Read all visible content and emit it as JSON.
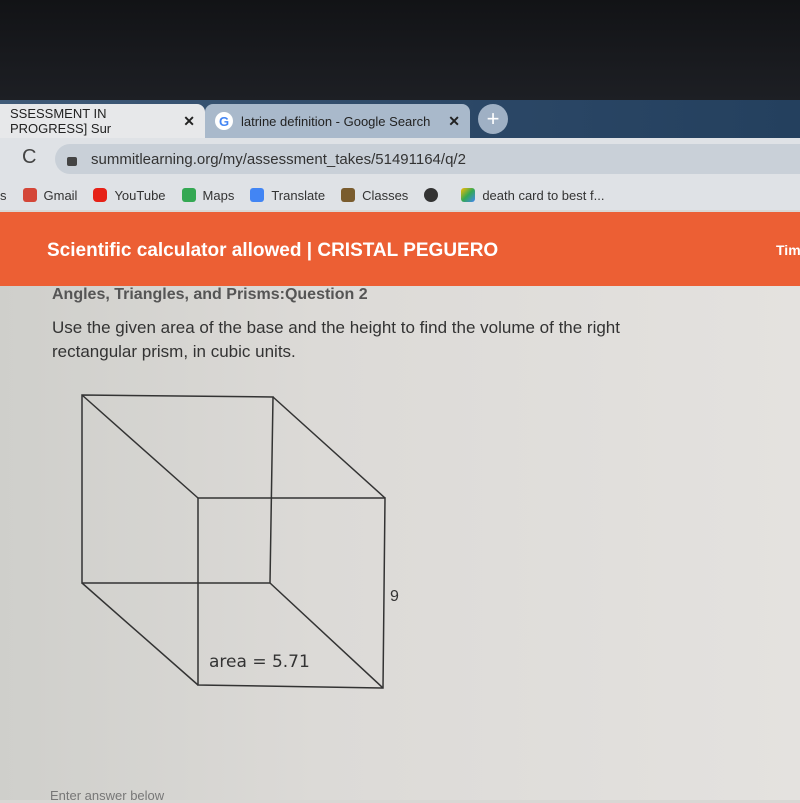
{
  "browser": {
    "tabs": [
      {
        "label": "SSESSMENT IN PROGRESS] Sur",
        "close": "✕"
      },
      {
        "label": "latrine definition - Google Search",
        "close": "✕",
        "icon": "google-icon"
      }
    ],
    "new_tab": "+",
    "url": "summitlearning.org/my/assessment_takes/51491164/q/2",
    "bookmarks": [
      {
        "label": "s"
      },
      {
        "label": "Gmail",
        "color": "#d44638"
      },
      {
        "label": "YouTube",
        "color": "#e62117"
      },
      {
        "label": "Maps",
        "color": "#34a853"
      },
      {
        "label": "Translate",
        "color": "#4285f4"
      },
      {
        "label": "Classes",
        "color": "#7a5c2e"
      },
      {
        "label": "",
        "color": "#333333"
      },
      {
        "label": "death card to best f...",
        "color": "#fbbc04"
      }
    ]
  },
  "banner": {
    "title": "Scientific calculator allowed | CRISTAL PEGUERO",
    "right": "Tim",
    "color": "#ec5f34"
  },
  "question": {
    "title": "Angles, Triangles, and Prisms:Question 2",
    "text": "Use the given area of the base and the height to find the volume of the right rectangular prism, in cubic units.",
    "height_label": "9",
    "area_label": "area = 5.71",
    "answer_prompt": "Enter answer below"
  }
}
